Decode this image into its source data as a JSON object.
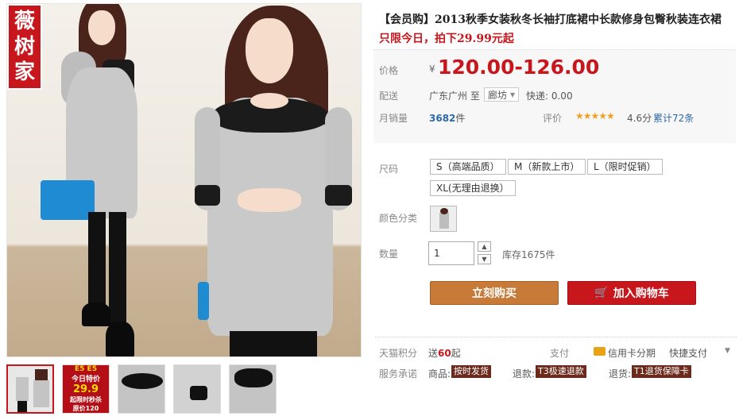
{
  "brand": {
    "logo_chars": [
      "薇",
      "树",
      "家"
    ]
  },
  "product": {
    "title": "【会员购】2013秋季女装秋冬长袖打底裙中长款修身包臀秋装连衣裙",
    "promo": "只限今日，拍下29.99元起"
  },
  "price": {
    "label": "价格",
    "symbol": "¥",
    "value": "120.00-126.00"
  },
  "shipping": {
    "label": "配送",
    "from": "广东广州 至",
    "to": "廊坊",
    "fee": "快递: 0.00"
  },
  "sales": {
    "label": "月销量",
    "count": "3682",
    "unit": "件"
  },
  "rating": {
    "label": "评价",
    "stars": "★★★★★",
    "score": "4.6分",
    "reviews": "累计72条"
  },
  "size": {
    "label": "尺码",
    "options": [
      "S（高端品质）",
      "M（新款上市）",
      "L（限时促销）",
      "XL(无理由退换）"
    ]
  },
  "color": {
    "label": "颜色分类"
  },
  "quantity": {
    "label": "数量",
    "value": "1",
    "up": "▲",
    "down": "▼",
    "stock": "库存1675件"
  },
  "actions": {
    "buy": "立刻购买",
    "cart": "加入购物车",
    "cart_icon": "🛒"
  },
  "points": {
    "label": "天猫积分",
    "prefix": "送",
    "value": "60",
    "suffix": "起"
  },
  "payment": {
    "label": "支付",
    "credit": "信用卡分期",
    "quick": "快捷支付"
  },
  "service": {
    "label": "服务承诺",
    "items": [
      {
        "prefix": "商品:",
        "tag": "按时发货"
      },
      {
        "prefix": "退款:",
        "tag": "T3极速退款"
      },
      {
        "prefix": "退货:",
        "tag": "T1退货保障卡"
      }
    ]
  },
  "thumbnails": {
    "promo": {
      "line1": "E5 E5",
      "line2": "今日特价",
      "price": "29.9",
      "line4": "起限时秒杀",
      "line5": "原价120"
    }
  },
  "colors": {
    "accent": "#c8161d",
    "buy": "#c87a38",
    "link": "#2d6aa5"
  }
}
